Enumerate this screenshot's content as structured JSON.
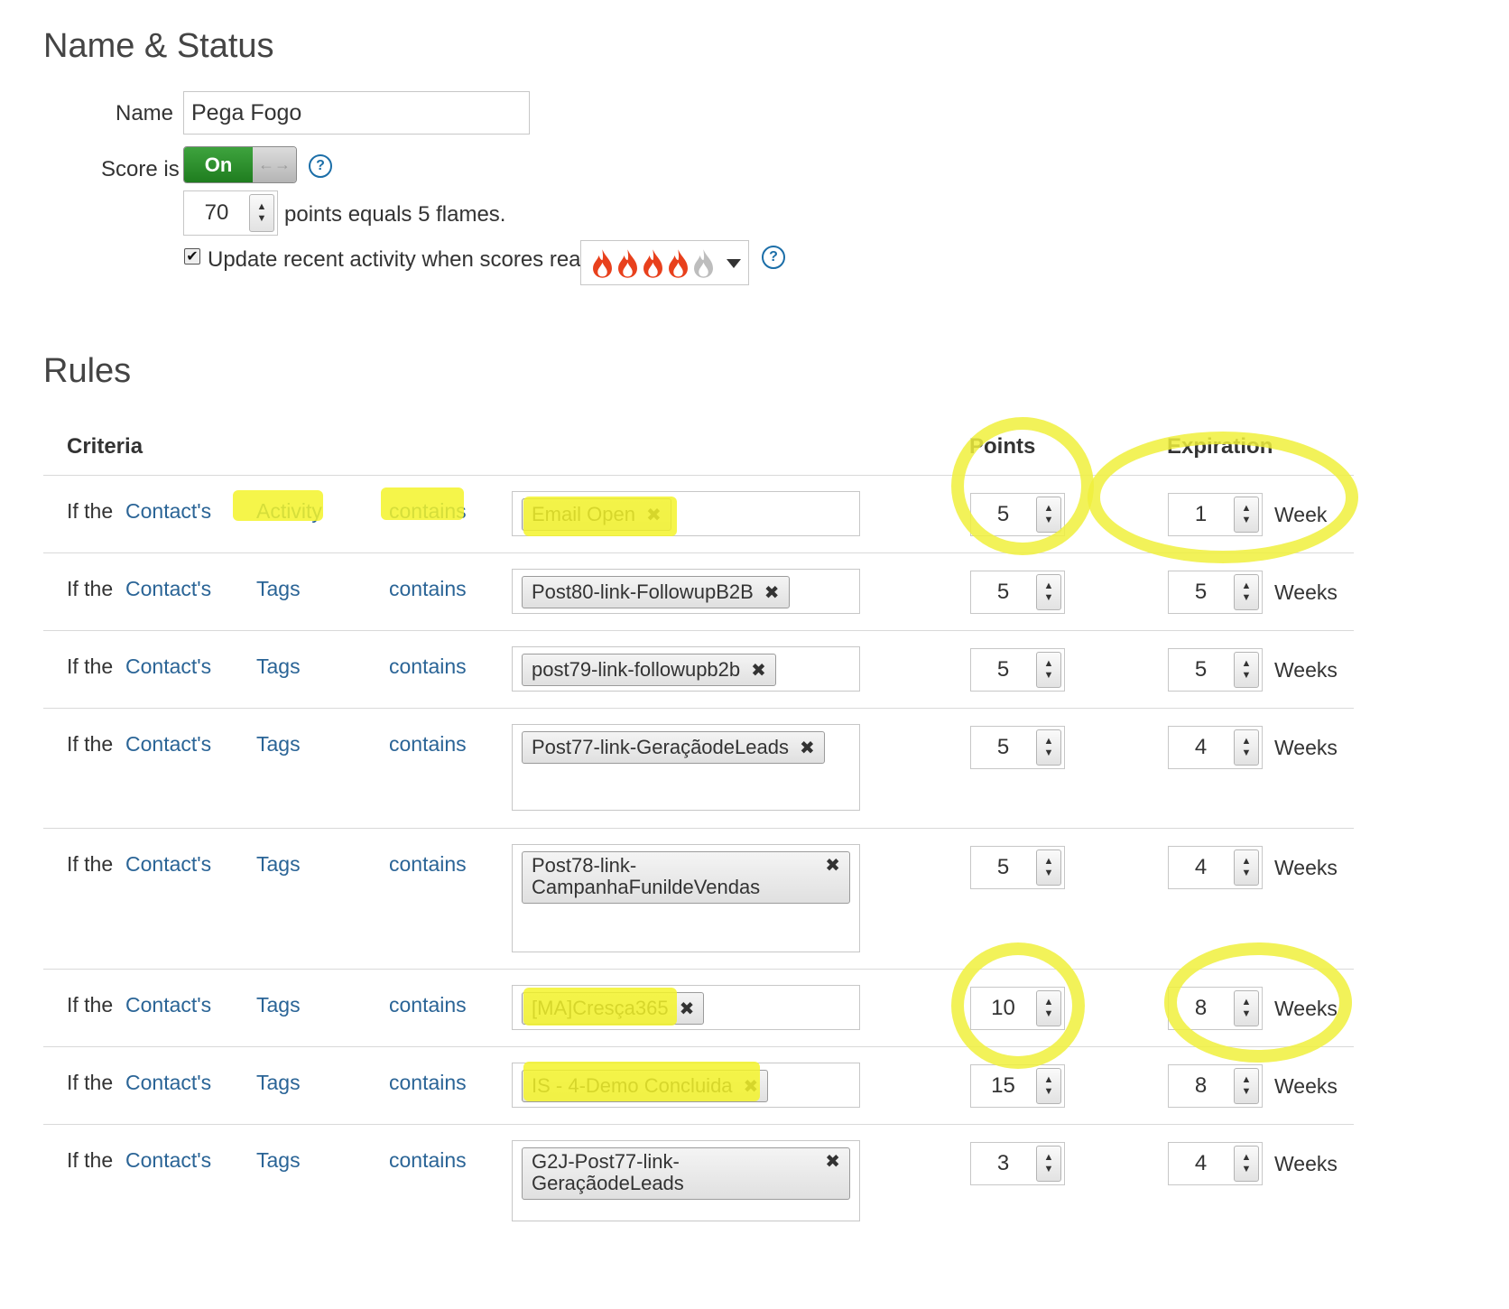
{
  "name_status": {
    "title": "Name & Status",
    "name_label": "Name",
    "name_value": "Pega Fogo",
    "score_label": "Score is",
    "toggle_on_label": "On",
    "toggle_off_glyph": "←→",
    "points_value": "70",
    "points_text": "points equals 5 flames.",
    "update_checked": true,
    "update_label": "Update recent activity when scores reach",
    "flames_selected": 4,
    "flames_total": 5,
    "help_glyph": "?"
  },
  "rules": {
    "title": "Rules",
    "headers": {
      "criteria": "Criteria",
      "points": "Points",
      "expiration": "Expiration"
    },
    "rows": [
      {
        "prefix": "If the",
        "subject": "Contact's",
        "field": "Activity",
        "operator": "contains",
        "value": "Email Open",
        "points": "5",
        "exp": "1",
        "unit": "Week"
      },
      {
        "prefix": "If the",
        "subject": "Contact's",
        "field": "Tags",
        "operator": "contains",
        "value": "Post80-link-FollowupB2B",
        "points": "5",
        "exp": "5",
        "unit": "Weeks"
      },
      {
        "prefix": "If the",
        "subject": "Contact's",
        "field": "Tags",
        "operator": "contains",
        "value": "post79-link-followupb2b",
        "points": "5",
        "exp": "5",
        "unit": "Weeks"
      },
      {
        "prefix": "If the",
        "subject": "Contact's",
        "field": "Tags",
        "operator": "contains",
        "value": "Post77-link-GeraçãodeLeads",
        "points": "5",
        "exp": "4",
        "unit": "Weeks"
      },
      {
        "prefix": "If the",
        "subject": "Contact's",
        "field": "Tags",
        "operator": "contains",
        "value": "Post78-link- CampanhaFunildeVendas",
        "points": "5",
        "exp": "4",
        "unit": "Weeks"
      },
      {
        "prefix": "If the",
        "subject": "Contact's",
        "field": "Tags",
        "operator": "contains",
        "value": "[MA]Cresça365",
        "points": "10",
        "exp": "8",
        "unit": "Weeks"
      },
      {
        "prefix": "If the",
        "subject": "Contact's",
        "field": "Tags",
        "operator": "contains",
        "value": "IS - 4-Demo Concluida",
        "points": "15",
        "exp": "8",
        "unit": "Weeks"
      },
      {
        "prefix": "If the",
        "subject": "Contact's",
        "field": "Tags",
        "operator": "contains",
        "value": "G2J-Post77-link- GeraçãodeLeads",
        "points": "3",
        "exp": "4",
        "unit": "Weeks"
      }
    ]
  },
  "colors": {
    "link": "#2a6496",
    "toggle_on": "#2e8b2e",
    "highlight": "#f3f32a",
    "flame_active": "#e8401c",
    "flame_inactive": "#bdbdbd"
  },
  "icons": {
    "chip_remove": "✖",
    "spinner_up": "▲",
    "spinner_down": "▼",
    "check": "✔"
  }
}
